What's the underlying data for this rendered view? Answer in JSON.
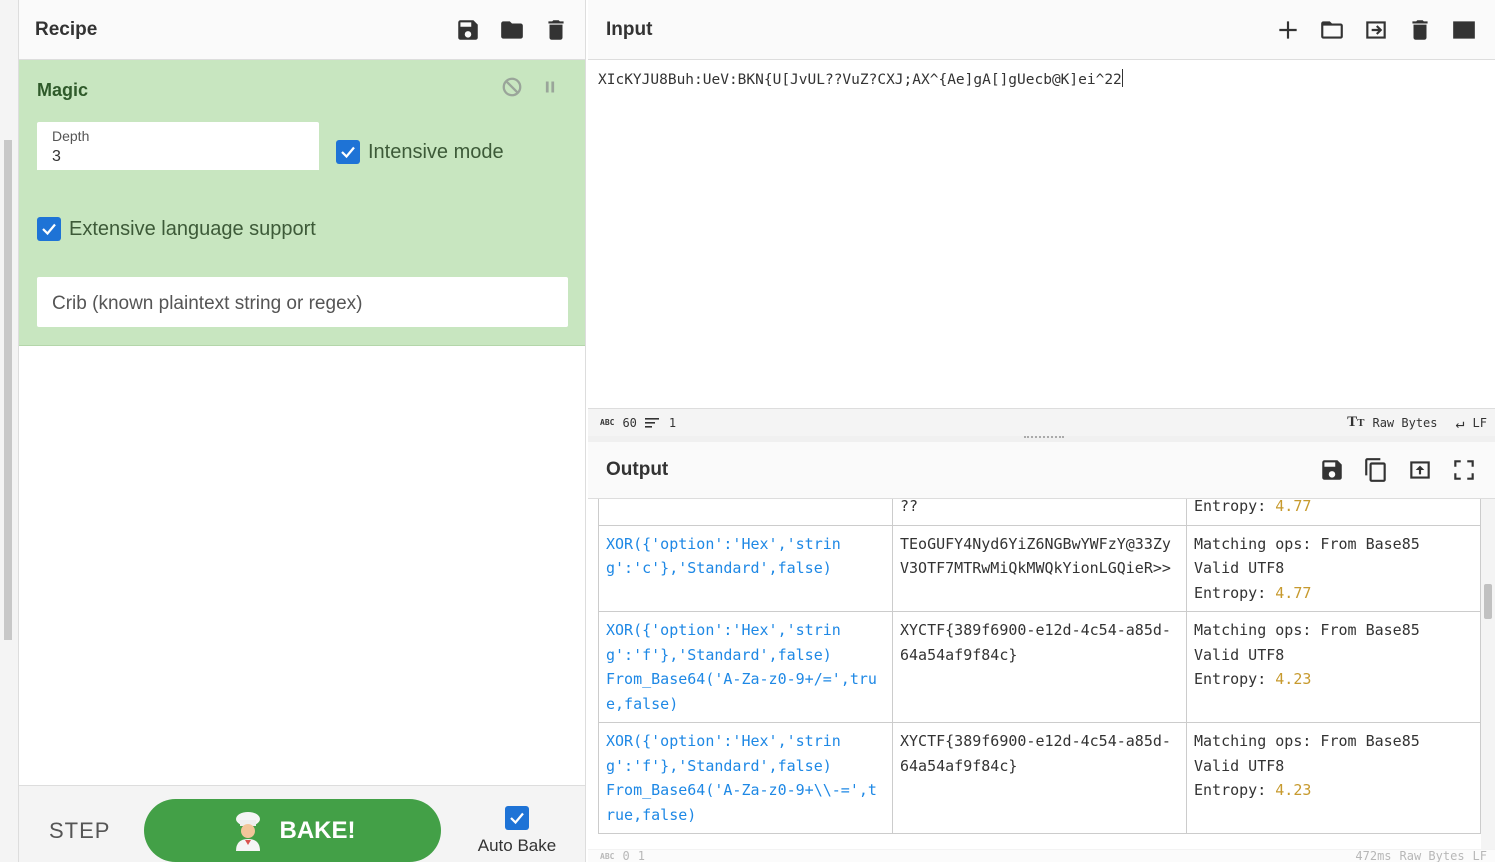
{
  "recipe": {
    "title": "Recipe",
    "magic": {
      "title": "Magic",
      "depth_label": "Depth",
      "depth_value": "3",
      "intensive_label": "Intensive mode",
      "extensive_label": "Extensive language support",
      "crib_placeholder": "Crib (known plaintext string or regex)"
    },
    "step_label": "STEP",
    "bake_label": "BAKE!",
    "autobake_label": "Auto Bake"
  },
  "input": {
    "title": "Input",
    "text": "XIcKYJU8Buh:UeV:BKN{U[JvUL??VuZ?CXJ;AX^{Ae]gA[]gUecb@K]ei^22",
    "status": {
      "abc_label": "ABC",
      "length": "60",
      "lines": "1",
      "raw_bytes": "Raw Bytes",
      "eol": "LF"
    }
  },
  "output": {
    "title": "Output",
    "rows": [
      {
        "recipe": "",
        "result": "??",
        "props": [
          "",
          "",
          "Entropy: "
        ],
        "entropy": "4.77"
      },
      {
        "recipe": "XOR({'option':'Hex','string':'c'},'Standard',false)",
        "result": "TEoGUFY4Nyd6YiZ6NGBwYWFzY@33ZyV3OTF7MTRwMiQkMWQkYionLGQieR>>",
        "props": [
          "Matching ops: From Base85",
          "Valid UTF8",
          "Entropy: "
        ],
        "entropy": "4.77"
      },
      {
        "recipe": "XOR({'option':'Hex','string':'f'},'Standard',false)\nFrom_Base64('A-Za-z0-9+/=',true,false)",
        "result": "XYCTF{389f6900-e12d-4c54-a85d-64a54af9f84c}",
        "props": [
          "Matching ops: From Base85",
          "Valid UTF8",
          "Entropy: "
        ],
        "entropy": "4.23"
      },
      {
        "recipe": "XOR({'option':'Hex','string':'f'},'Standard',false)\nFrom_Base64('A-Za-z0-9+\\\\-=',true,false)",
        "result": "XYCTF{389f6900-e12d-4c54-a85d-64a54af9f84c}",
        "props": [
          "Matching ops: From Base85",
          "Valid UTF8",
          "Entropy: "
        ],
        "entropy": "4.23"
      }
    ],
    "status": {
      "abc_label": "ABC",
      "length": "0",
      "lines": "1",
      "time": "472ms",
      "raw_bytes": "Raw Bytes",
      "eol": "LF"
    }
  }
}
